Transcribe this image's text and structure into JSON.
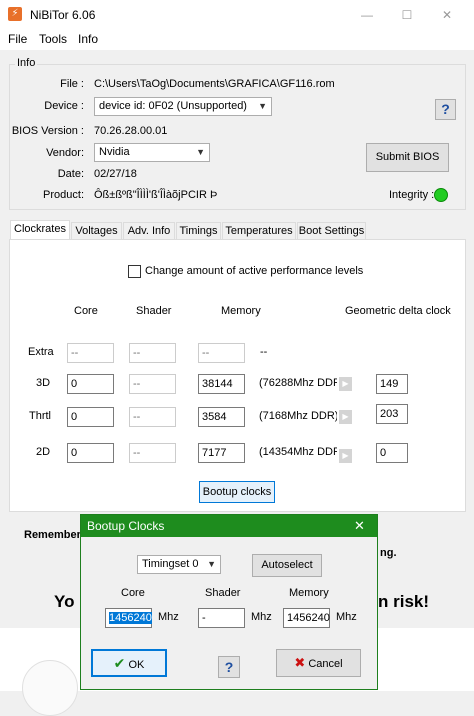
{
  "window": {
    "title": "NiBiTor 6.06"
  },
  "menu": {
    "file": "File",
    "tools": "Tools",
    "info": "Info"
  },
  "info": {
    "group_label": "Info",
    "file_label": "File :",
    "file_value": "C:\\Users\\TaOg\\Documents\\GRAFICA\\GF116.rom",
    "device_label": "Device :",
    "device_value": "device id: 0F02 (Unsupported)",
    "bios_label": "BIOS Version :",
    "bios_value": "70.26.28.00.01",
    "vendor_label": "Vendor:",
    "vendor_value": "Nvidia",
    "date_label": "Date:",
    "date_value": "02/27/18",
    "product_label": "Product:",
    "product_value": "Ôß±ßºß\"ÎÌÌÌ'ß'ÎÌàõjPCIR Þ",
    "submit_label": "Submit BIOS",
    "integrity_label": "Integrity :",
    "integrity_color": "#22cc22",
    "help_glyph": "?"
  },
  "tabs": [
    "Clockrates",
    "Voltages",
    "Adv. Info",
    "Timings",
    "Temperatures",
    "Boot Settings"
  ],
  "clockrates": {
    "change_levels_label": "Change amount of active performance levels",
    "headers": {
      "core": "Core",
      "shader": "Shader",
      "memory": "Memory",
      "delta": "Geometric delta clock"
    },
    "rows": [
      {
        "label": "Extra",
        "core": "--",
        "shader": "--",
        "memory": "--",
        "ddr": "--",
        "delta": ""
      },
      {
        "label": "3D",
        "core": "0",
        "shader": "--",
        "memory": "38144",
        "ddr": "(76288Mhz DDR",
        "delta": "149"
      },
      {
        "label": "Thrtl",
        "core": "0",
        "shader": "--",
        "memory": "3584",
        "ddr": "(7168Mhz DDR)",
        "delta": "203"
      },
      {
        "label": "2D",
        "core": "0",
        "shader": "--",
        "memory": "7177",
        "ddr": "(14354Mhz DDR",
        "delta": "0"
      }
    ],
    "bootup_label": "Bootup clocks"
  },
  "background": {
    "remember": "Remember",
    "remember_tail": "ng.",
    "big_left": "Yo",
    "big_right": "n risk!"
  },
  "dialog": {
    "title": "Bootup Clocks",
    "close_glyph": "✕",
    "timingset_value": "Timingset 0",
    "autoselect_label": "Autoselect",
    "core_label": "Core",
    "shader_label": "Shader",
    "memory_label": "Memory",
    "core_value": "1456240",
    "shader_value": "-",
    "memory_value": "1456240",
    "unit": "Mhz",
    "ok_label": "OK",
    "cancel_label": "Cancel",
    "help_glyph": "?"
  }
}
